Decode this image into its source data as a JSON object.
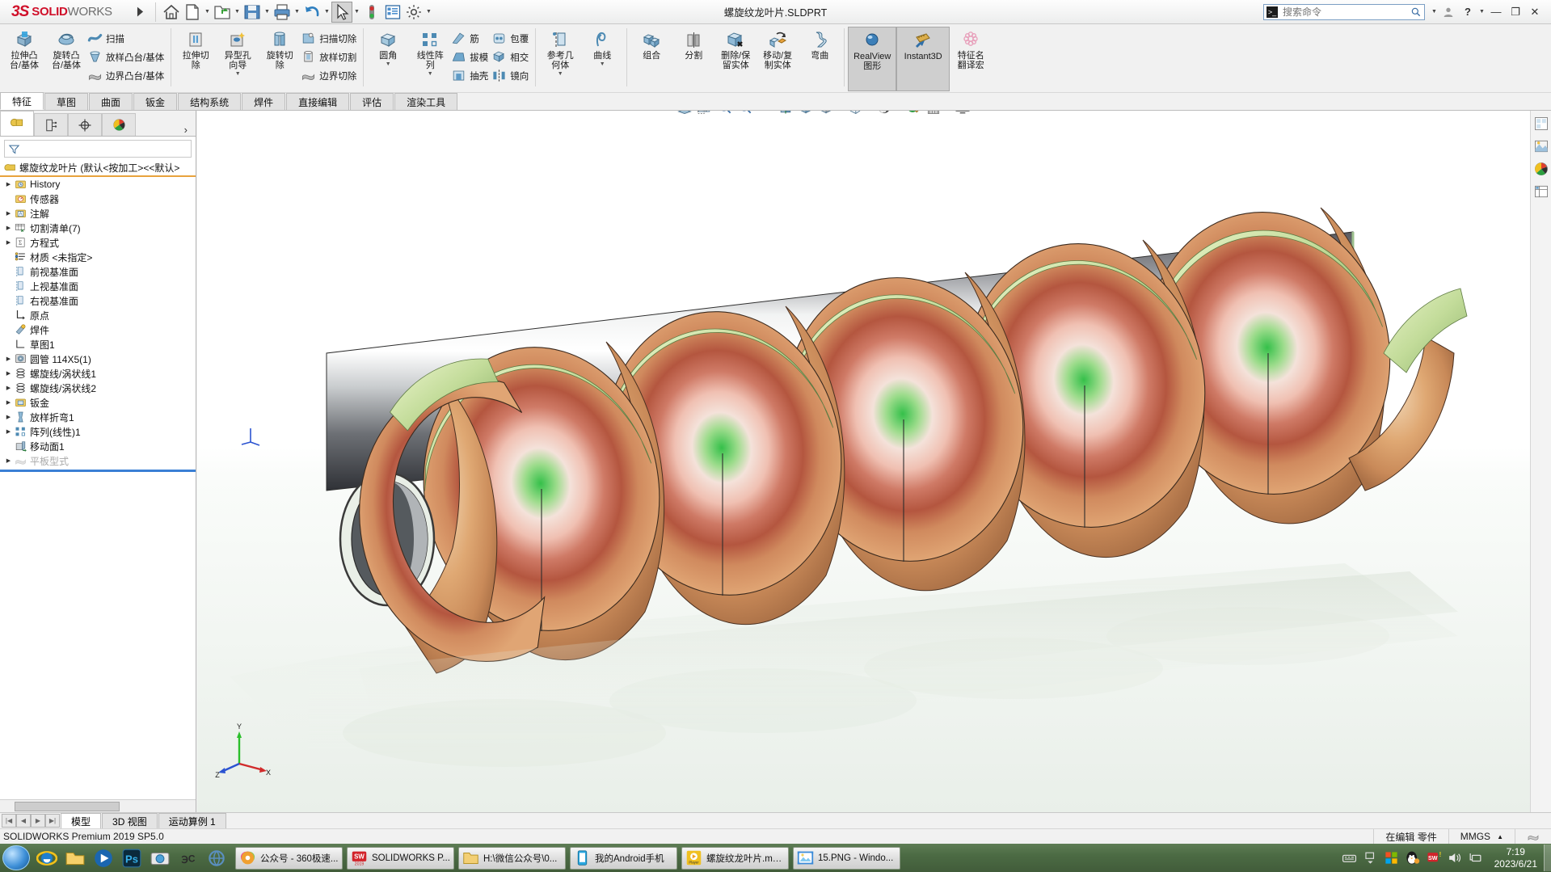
{
  "titlebar": {
    "brand_mark": "3S",
    "brand_name": "SOLID",
    "brand_name_light": "WORKS",
    "document_title": "螺旋纹龙叶片.SLDPRT",
    "quick_access": [
      {
        "name": "home-icon",
        "label": "主页"
      },
      {
        "name": "new-document-icon",
        "label": "新建"
      },
      {
        "name": "open-folder-icon",
        "label": "打开"
      },
      {
        "name": "save-icon",
        "label": "保存"
      },
      {
        "name": "print-icon",
        "label": "打印"
      },
      {
        "name": "undo-icon",
        "label": "撤消"
      },
      {
        "name": "select-cursor-icon",
        "label": "选择"
      },
      {
        "name": "rebuild-icon",
        "label": "重建模型"
      },
      {
        "name": "file-properties-icon",
        "label": "文件属性"
      },
      {
        "name": "options-gear-icon",
        "label": "选项"
      }
    ],
    "search_placeholder": "搜索命令",
    "window_buttons": [
      "minimize",
      "restore",
      "close"
    ]
  },
  "ribbon": {
    "groups": [
      {
        "big": [
          {
            "label": "拉伸凸\n台/基体",
            "icon": "extrude-boss-icon"
          },
          {
            "label": "旋转凸\n台/基体",
            "icon": "revolve-boss-icon"
          }
        ],
        "small": [
          {
            "label": "扫描",
            "icon": "sweep-icon"
          },
          {
            "label": "放样凸台/基体",
            "icon": "loft-boss-icon"
          },
          {
            "label": "边界凸台/基体",
            "icon": "boundary-boss-icon"
          }
        ]
      },
      {
        "big": [
          {
            "label": "拉伸切\n除",
            "icon": "extrude-cut-icon"
          },
          {
            "label": "异型孔\n向导",
            "icon": "hole-wizard-icon",
            "has_arrow": true
          },
          {
            "label": "旋转切\n除",
            "icon": "revolve-cut-icon"
          }
        ],
        "small": [
          {
            "label": "扫描切除",
            "icon": "sweep-cut-icon"
          },
          {
            "label": "放样切割",
            "icon": "loft-cut-icon"
          },
          {
            "label": "边界切除",
            "icon": "boundary-cut-icon"
          }
        ]
      },
      {
        "big": [
          {
            "label": "圆角",
            "icon": "fillet-icon",
            "has_arrow": true
          },
          {
            "label": "线性阵\n列",
            "icon": "linear-pattern-icon",
            "has_arrow": true
          }
        ],
        "small": [
          {
            "label": "筋",
            "icon": "rib-icon"
          },
          {
            "label": "拔模",
            "icon": "draft-icon"
          },
          {
            "label": "抽壳",
            "icon": "shell-icon"
          }
        ],
        "small2": [
          {
            "label": "包覆",
            "icon": "wrap-icon"
          },
          {
            "label": "相交",
            "icon": "intersect-icon"
          },
          {
            "label": "镜向",
            "icon": "mirror-icon"
          }
        ]
      },
      {
        "big": [
          {
            "label": "参考几\n何体",
            "icon": "reference-geometry-icon",
            "has_arrow": true
          },
          {
            "label": "曲线",
            "icon": "curves-icon",
            "has_arrow": true
          }
        ]
      },
      {
        "big": [
          {
            "label": "组合",
            "icon": "combine-icon"
          },
          {
            "label": "分割",
            "icon": "split-icon"
          },
          {
            "label": "删除/保\n留实体",
            "icon": "delete-keep-body-icon"
          },
          {
            "label": "移动/复\n制实体",
            "icon": "move-copy-body-icon"
          },
          {
            "label": "弯曲",
            "icon": "flex-icon"
          }
        ]
      },
      {
        "big": [
          {
            "label": "RealView\n图形",
            "icon": "realview-sphere-icon",
            "selected": true
          },
          {
            "label": "Instant3D",
            "icon": "instant3d-ruler-icon",
            "selected": true
          },
          {
            "label": "特征名\n翻译宏",
            "icon": "macro-flower-icon"
          }
        ]
      }
    ],
    "tabs": [
      {
        "label": "特征",
        "active": true
      },
      {
        "label": "草图",
        "active": false
      },
      {
        "label": "曲面",
        "active": false
      },
      {
        "label": "钣金",
        "active": false
      },
      {
        "label": "结构系统",
        "active": false
      },
      {
        "label": "焊件",
        "active": false
      },
      {
        "label": "直接编辑",
        "active": false
      },
      {
        "label": "评估",
        "active": false
      },
      {
        "label": "渲染工具",
        "active": false
      }
    ]
  },
  "feature_manager": {
    "tabs": [
      {
        "name": "feature-tree-tab",
        "icon": "feature-tree-icon",
        "active": true
      },
      {
        "name": "property-manager-tab",
        "icon": "property-manager-icon",
        "active": false
      },
      {
        "name": "configuration-manager-tab",
        "icon": "configuration-icon",
        "active": false
      },
      {
        "name": "display-manager-tab",
        "icon": "display-manager-icon",
        "active": false
      }
    ],
    "filter_placeholder": "",
    "root": "螺旋纹龙叶片  (默认<按加工><<默认>",
    "items": [
      {
        "label": "History",
        "icon": "history-icon",
        "expandable": true,
        "indent": 0
      },
      {
        "label": "传感器",
        "icon": "sensor-icon",
        "expandable": false,
        "indent": 0
      },
      {
        "label": "注解",
        "icon": "annotations-icon",
        "expandable": true,
        "indent": 0
      },
      {
        "label": "切割清单(7)",
        "icon": "cutlist-icon",
        "expandable": true,
        "indent": 0
      },
      {
        "label": "方程式",
        "icon": "equations-icon",
        "expandable": true,
        "indent": 0
      },
      {
        "label": "材质 <未指定>",
        "icon": "material-icon",
        "expandable": false,
        "indent": 0
      },
      {
        "label": "前视基准面",
        "icon": "plane-icon",
        "expandable": false,
        "indent": 0
      },
      {
        "label": "上视基准面",
        "icon": "plane-icon",
        "expandable": false,
        "indent": 0
      },
      {
        "label": "右视基准面",
        "icon": "plane-icon",
        "expandable": false,
        "indent": 0
      },
      {
        "label": "原点",
        "icon": "origin-icon",
        "expandable": false,
        "indent": 0
      },
      {
        "label": "焊件",
        "icon": "weldment-icon",
        "expandable": false,
        "indent": 0
      },
      {
        "label": "草图1",
        "icon": "sketch-icon",
        "expandable": false,
        "indent": 0
      },
      {
        "label": "圆管 114X5(1)",
        "icon": "structural-member-icon",
        "expandable": true,
        "indent": 0
      },
      {
        "label": "螺旋线/涡状线1",
        "icon": "helix-icon",
        "expandable": true,
        "indent": 0
      },
      {
        "label": "螺旋线/涡状线2",
        "icon": "helix-icon",
        "expandable": true,
        "indent": 0
      },
      {
        "label": "钣金",
        "icon": "sheetmetal-icon",
        "expandable": true,
        "indent": 0
      },
      {
        "label": "放样折弯1",
        "icon": "lofted-bend-icon",
        "expandable": true,
        "indent": 0
      },
      {
        "label": "阵列(线性)1",
        "icon": "linear-pattern-icon",
        "expandable": true,
        "indent": 0
      },
      {
        "label": "移动面1",
        "icon": "move-face-icon",
        "expandable": false,
        "indent": 0
      },
      {
        "label": "平板型式",
        "icon": "flat-pattern-icon",
        "expandable": true,
        "indent": 0,
        "dimmed": true
      }
    ]
  },
  "view_toolbar": [
    {
      "name": "zoom-to-fit-icon"
    },
    {
      "name": "zoom-to-area-icon"
    },
    {
      "name": "zoom-in-out-icon"
    },
    {
      "name": "previous-view-icon"
    },
    {
      "name": "section-view-icon"
    },
    {
      "name": "view-orientation-icon"
    },
    {
      "name": "display-style-icon"
    },
    {
      "name": "hide-show-items-icon"
    },
    {
      "name": "edit-appearance-icon"
    },
    {
      "name": "apply-scene-icon"
    },
    {
      "name": "view-settings-icon"
    }
  ],
  "graphics_sidebar": [
    {
      "name": "view-palette-icon"
    },
    {
      "name": "appearances-icon"
    },
    {
      "name": "custom-properties-icon"
    },
    {
      "name": "display-pane-icon"
    }
  ],
  "bottom_tabs": [
    {
      "label": "模型",
      "active": true
    },
    {
      "label": "3D 视图",
      "active": false
    },
    {
      "label": "运动算例 1",
      "active": false
    }
  ],
  "statusbar": {
    "product": "SOLIDWORKS Premium 2019 SP5.0",
    "edit_state": "在编辑 零件",
    "units": "MMGS"
  },
  "taskbar": {
    "quick_launch": [
      {
        "name": "ie-icon"
      },
      {
        "name": "explorer-icon"
      },
      {
        "name": "media-player-icon"
      },
      {
        "name": "photoshop-icon"
      },
      {
        "name": "camera-icon"
      },
      {
        "name": "solidworks-qicon"
      },
      {
        "name": "network-tool-icon"
      }
    ],
    "tasks": [
      {
        "label": "公众号 - 360极速...",
        "icon": "browser-360-icon"
      },
      {
        "label": "SOLIDWORKS P...",
        "icon": "solidworks-2019-icon"
      },
      {
        "label": "H:\\微信公众号\\0...",
        "icon": "folder-icon"
      },
      {
        "label": "我的Android手机",
        "icon": "phone-icon"
      },
      {
        "label": "螺旋纹龙叶片.mp...",
        "icon": "player-icon"
      },
      {
        "label": "15.PNG - Windo...",
        "icon": "photo-viewer-icon"
      }
    ],
    "tray": [
      {
        "name": "keyboard-ime-icon"
      },
      {
        "name": "tray-expand-icon"
      },
      {
        "name": "windows-flag-icon"
      },
      {
        "name": "qq-penguin-icon"
      },
      {
        "name": "antivirus-icon"
      },
      {
        "name": "volume-icon"
      },
      {
        "name": "network-icon"
      }
    ],
    "clock_time": "7:19",
    "clock_date": "2023/6/21"
  },
  "colors": {
    "brand_red": "#d0102a",
    "tree_accent": "#e8a33d",
    "taskbar_green": "#4c6b44",
    "selection_blue": "#3a7fd5"
  }
}
